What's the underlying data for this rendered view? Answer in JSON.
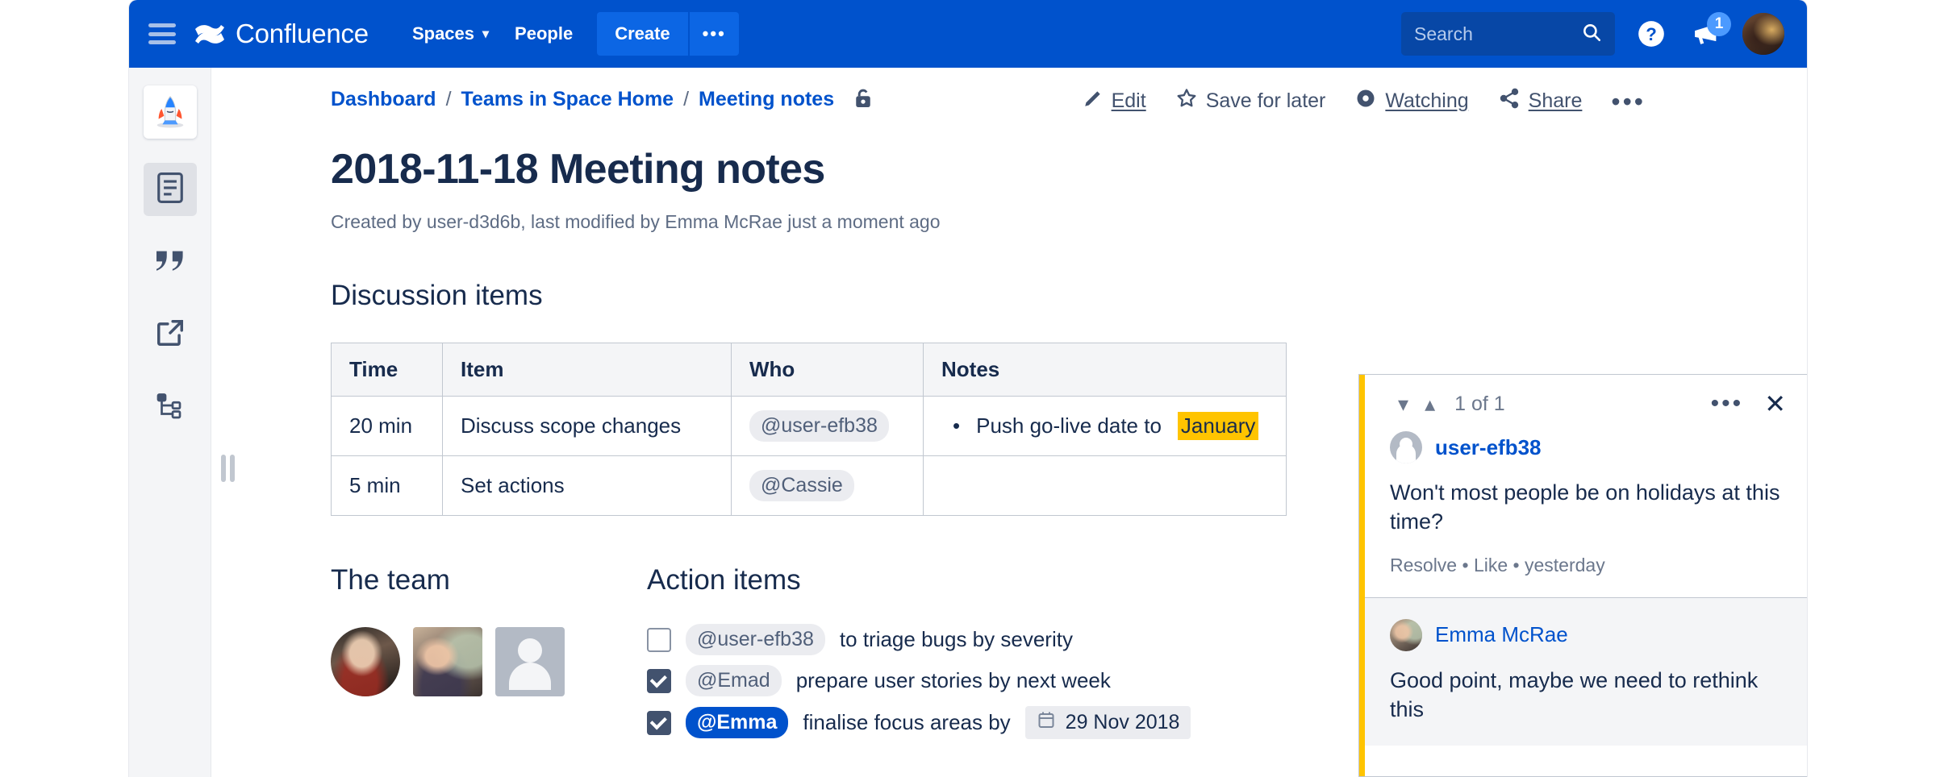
{
  "topnav": {
    "menu_icon": "hamburger-icon",
    "brand": "Confluence",
    "spaces": "Spaces",
    "people": "People",
    "create": "Create",
    "create_more": "•••",
    "search_placeholder": "Search",
    "search_value": "",
    "search_icon": "search-icon",
    "help_icon": "help-icon",
    "notifications_icon": "megaphone-icon",
    "notifications_count": "1",
    "avatar": "user-avatar",
    "bg_color": "#0052CC",
    "create_color": "#0C66E4"
  },
  "sidebar": {
    "space_logo": "rocket-space-logo",
    "items": [
      {
        "name": "pages",
        "icon": "page-icon",
        "active": true
      },
      {
        "name": "blog",
        "icon": "quote-icon",
        "active": false
      },
      {
        "name": "shortcuts",
        "icon": "external-link-icon",
        "active": false
      },
      {
        "name": "page-tree",
        "icon": "page-tree-icon",
        "active": false
      }
    ]
  },
  "breadcrumb": {
    "items": [
      "Dashboard",
      "Teams in Space Home",
      "Meeting notes"
    ],
    "separator": "/",
    "restriction_icon": "unlocked-padlock-icon"
  },
  "actionbar": {
    "edit": "Edit",
    "save_for_later": "Save for later",
    "watching": "Watching",
    "share": "Share",
    "more": "•••"
  },
  "page": {
    "title": "2018-11-18 Meeting notes",
    "meta": "Created by user-d3d6b, last modified by Emma McRae just a moment ago"
  },
  "discussion": {
    "heading": "Discussion items",
    "columns": [
      "Time",
      "Item",
      "Who",
      "Notes"
    ],
    "rows": [
      {
        "time": "20 min",
        "item": "Discuss scope changes",
        "who": "@user-efb38",
        "note_prefix": "Push go-live date to ",
        "note_highlight": "January"
      },
      {
        "time": "5 min",
        "item": "Set actions",
        "who": "@Cassie",
        "note_prefix": "",
        "note_highlight": ""
      }
    ],
    "highlight_color": "#FFC400"
  },
  "team": {
    "heading": "The team",
    "members": [
      "avatar-photo-round",
      "avatar-photo-square",
      "avatar-placeholder"
    ]
  },
  "actions": {
    "heading": "Action items",
    "items": [
      {
        "checked": false,
        "mention": "@user-efb38",
        "mention_style": "grey",
        "text": "to triage bugs by severity",
        "date": ""
      },
      {
        "checked": true,
        "mention": "@Emad",
        "mention_style": "grey",
        "text": "prepare user stories by next week",
        "date": ""
      },
      {
        "checked": true,
        "mention": "@Emma",
        "mention_style": "blue",
        "text": "finalise focus areas by",
        "date": "29 Nov 2018"
      }
    ]
  },
  "comments": {
    "counter": "1 of 1",
    "prev_icon": "chevron-down-icon",
    "next_icon": "chevron-up-icon",
    "more": "•••",
    "close": "✕",
    "accent_color": "#FFC400",
    "list": [
      {
        "author": "user-efb38",
        "body": "Won't most people be on holidays at this time?",
        "resolve": "Resolve",
        "like": "Like",
        "time": "yesterday",
        "sep": "•"
      },
      {
        "author": "Emma McRae",
        "body": "Good point, maybe we need to rethink this"
      }
    ]
  }
}
